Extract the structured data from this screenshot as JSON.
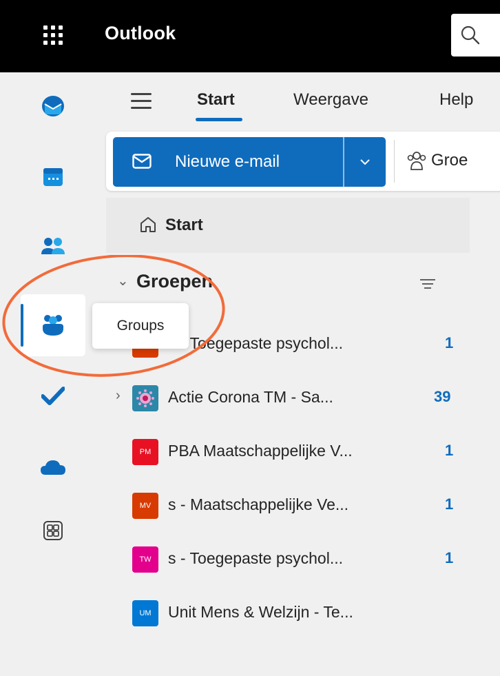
{
  "app": {
    "title": "Outlook"
  },
  "colors": {
    "accent": "#0f6cbd",
    "annotation": "#f26b3a"
  },
  "rail": {
    "items": [
      {
        "icon": "mail-icon"
      },
      {
        "icon": "calendar-icon"
      },
      {
        "icon": "people-icon"
      },
      {
        "icon": "groups-icon",
        "active": true,
        "tooltip": "Groups"
      },
      {
        "icon": "todo-icon"
      },
      {
        "icon": "onedrive-icon"
      },
      {
        "icon": "more-apps-icon"
      }
    ]
  },
  "tabs": [
    {
      "label": "Start",
      "active": true
    },
    {
      "label": "Weergave"
    },
    {
      "label": "Help"
    }
  ],
  "ribbon": {
    "new_mail_label": "Nieuwe e-mail",
    "groups_label": "Groe"
  },
  "nav": {
    "start_label": "Start",
    "section_label": "Groepen",
    "groups": [
      {
        "initials": "",
        "color": "#d83b01",
        "name": "s - Toegepaste psychol...",
        "count": "1"
      },
      {
        "initials": "",
        "color": "#2b88a8",
        "name": "Actie Corona TM - Sa...",
        "count": "39",
        "expandable": true
      },
      {
        "initials": "PM",
        "color": "#e81123",
        "name": "PBA Maatschappelijke V...",
        "count": "1"
      },
      {
        "initials": "MV",
        "color": "#d83b01",
        "name": "s - Maatschappelijke Ve...",
        "count": "1"
      },
      {
        "initials": "TW",
        "color": "#e3008c",
        "name": "s - Toegepaste psychol...",
        "count": "1"
      },
      {
        "initials": "UM",
        "color": "#0078d4",
        "name": "Unit Mens & Welzijn - Te...",
        "count": ""
      }
    ]
  }
}
